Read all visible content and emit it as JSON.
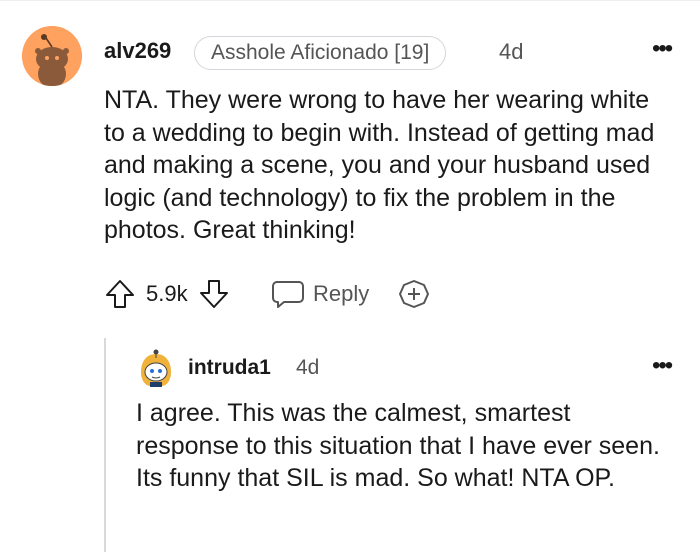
{
  "comment": {
    "username": "alv269",
    "flair": "Asshole Aficionado [19]",
    "timestamp": "4d",
    "more_label": "•••",
    "body": "NTA. They were wrong to have her wearing white to a wedding to begin with. Instead of getting mad and making a scene, you and your husband used logic (and technology) to fix the problem in the photos. Great thinking!",
    "score": "5.9k",
    "reply_label": "Reply",
    "avatar_color": "#ff9d5c"
  },
  "reply": {
    "username": "intruda1",
    "timestamp": "4d",
    "more_label": "•••",
    "body": "I agree. This was the calmest, smartest response to this situation that I have ever seen. Its funny that SIL is mad. So what! NTA OP."
  }
}
